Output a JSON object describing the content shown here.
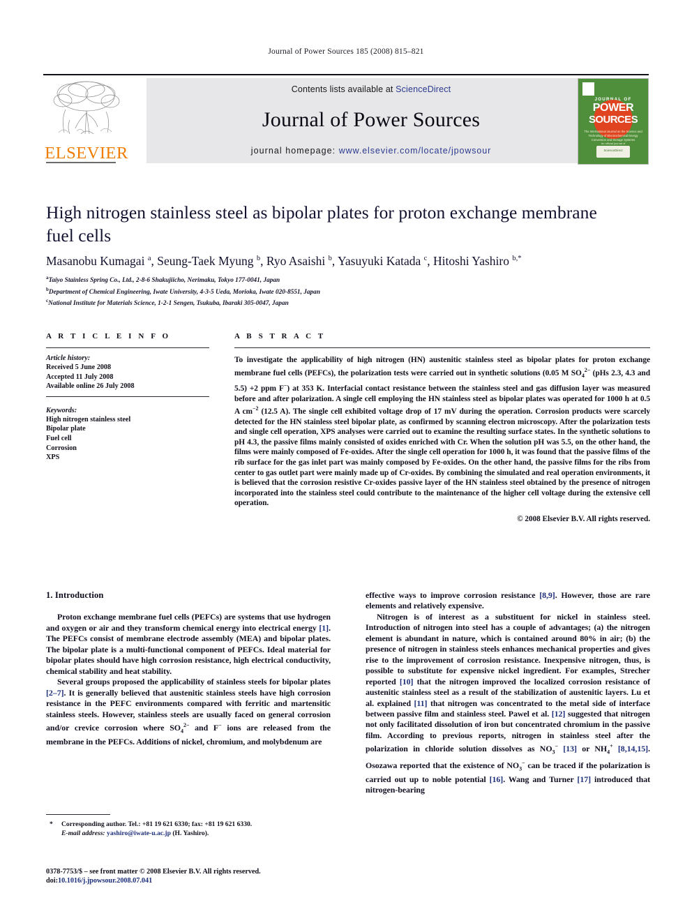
{
  "running_head": "Journal of Power Sources 185 (2008) 815–821",
  "masthead": {
    "publisher_logo_text": "ELSEVIER",
    "contents_prefix": "Contents lists available at ",
    "contents_link": "ScienceDirect",
    "journal_name": "Journal of Power Sources",
    "homepage_prefix": "journal homepage:",
    "homepage_url": "www.elsevier.com/locate/jpowsour",
    "cover": {
      "line1": "JOURNAL OF",
      "line2": "POWER",
      "line3": "SOURCES",
      "tagline": "The International Journal on the Science and Technology of Electro­chemical Energy Conversion and Storage Systems",
      "badge_top": "An official journal of",
      "badge": "ScienceDirect",
      "bg_color": "#4f8f3b",
      "circle_color": "#e0431f"
    }
  },
  "article": {
    "title": "High nitrogen stainless steel as bipolar plates for proton exchange membrane fuel cells",
    "authors_html": "Masanobu Kumagai <sup>a</sup>, Seung-Taek Myung <sup>b</sup>, Ryo Asaishi <sup>b</sup>, Yasuyuki Katada <sup>c</sup>, Hitoshi Yashiro <sup>b,*</sup>",
    "affiliations": [
      {
        "mark": "a",
        "text": "Taiyo Stainless Spring Co., Ltd., 2-8-6 Shakujiicho, Nerimaku, Tokyo 177-0041, Japan"
      },
      {
        "mark": "b",
        "text": "Department of Chemical Engineering, Iwate University, 4-3-5 Ueda, Morioka, Iwate 020-8551, Japan"
      },
      {
        "mark": "c",
        "text": "National Institute for Materials Science, 1-2-1 Sengen, Tsukuba, Ibaraki 305-0047, Japan"
      }
    ]
  },
  "article_info": {
    "heading": "A R T I C L E   I N F O",
    "history_label": "Article history:",
    "history": [
      "Received 5 June 2008",
      "Accepted 11 July 2008",
      "Available online 26 July 2008"
    ],
    "keywords_label": "Keywords:",
    "keywords": [
      "High nitrogen stainless steel",
      "Bipolar plate",
      "Fuel cell",
      "Corrosion",
      "XPS"
    ]
  },
  "abstract": {
    "heading": "A B S T R A C T",
    "text_html": "To investigate the applicability of high nitrogen (HN) austenitic stainless steel as bipolar plates for proton exchange membrane fuel cells (PEFCs), the polarization tests were carried out in synthetic solutions (0.05 M SO<sub>4</sub><sup>2−</sup> (pHs 2.3, 4.3 and 5.5) +2 ppm F<sup>−</sup>) at 353 K. Interfacial contact resistance between the stainless steel and gas diffusion layer was measured before and after polarization. A single cell employing the HN stainless steel as bipolar plates was operated for 1000 h at 0.5 A cm<sup>−2</sup> (12.5 A). The single cell exhibited voltage drop of 17 mV during the operation. Corrosion products were scarcely detected for the HN stainless steel bipolar plate, as confirmed by scanning electron microscopy. After the polarization tests and single cell operation, XPS analyses were carried out to examine the resulting surface states. In the synthetic solutions to pH 4.3, the passive films mainly consisted of oxides enriched with Cr. When the solution pH was 5.5, on the other hand, the films were mainly composed of Fe-oxides. After the single cell operation for 1000 h, it was found that the passive films of the rib surface for the gas inlet part was mainly composed by Fe-oxides. On the other hand, the passive films for the ribs from center to gas outlet part were mainly made up of Cr-oxides. By combining the simulated and real operation environments, it is believed that the corrosion resistive Cr-oxides passive layer of the HN stainless steel obtained by the presence of nitrogen incorporated into the stainless steel could contribute to the maintenance of the higher cell voltage during the extensive cell operation.",
    "copyright": "© 2008 Elsevier B.V. All rights reserved."
  },
  "body": {
    "section_heading": "1.  Introduction",
    "left_paragraphs_html": [
      "Proton exchange membrane fuel cells (PEFCs) are systems that use hydrogen and oxygen or air and they transform chemical energy into electrical energy <span class=\"ref\">[1]</span>. The PEFCs consist of membrane electrode assembly (MEA) and bipolar plates. The bipolar plate is a multi-functional component of PEFCs. Ideal material for bipolar plates should have high corrosion resistance, high electrical conductivity, chemical stability and heat stability.",
      "Several groups proposed the applicability of stainless steels for bipolar plates <span class=\"ref\">[2–7]</span>. It is generally believed that austenitic stainless steels have high corrosion resistance in the PEFC environments compared with ferritic and martensitic stainless steels. However, stainless steels are usually faced on general corrosion and/or crevice corrosion where SO<sub>4</sub><sup>2−</sup> and F<sup>−</sup> ions are released from the membrane in the PEFCs. Additions of nickel, chromium, and molybdenum are"
    ],
    "right_paragraphs_html": [
      "effective ways to improve corrosion resistance <span class=\"ref\">[8,9]</span>. However, those are rare elements and relatively expensive.",
      "Nitrogen is of interest as a substituent for nickel in stainless steel. Introduction of nitrogen into steel has a couple of advantages; (a) the nitrogen element is abundant in nature, which is contained around 80% in air; (b) the presence of nitrogen in stainless steels enhances mechanical properties and gives rise to the improvement of corrosion resistance. Inexpensive nitrogen, thus, is possible to substitute for expensive nickel ingredient. For examples, Strecher reported <span class=\"ref\">[10]</span> that the nitrogen improved the localized corrosion resistance of austenitic stainless steel as a result of the stabilization of austenitic layers. Lu et al. explained <span class=\"ref\">[11]</span> that nitrogen was concentrated to the metal side of interface between passive film and stainless steel. Pawel et al. <span class=\"ref\">[12]</span> suggested that nitrogen not only facilitated dissolution of iron but concentrated chromium in the passive film. According to previous reports, nitrogen in stainless steel after the polarization in chloride solution dissolves as NO<sub>3</sub><sup>−</sup> <span class=\"ref\">[13]</span> or NH<sub>4</sub><sup>+</sup> <span class=\"ref\">[8,14,15]</span>. Osozawa reported that the existence of NO<sub>3</sub><sup>−</sup> can be traced if the polarization is carried out up to noble potential <span class=\"ref\">[16]</span>. Wang and Turner <span class=\"ref\">[17]</span> introduced that nitrogen-bearing"
    ]
  },
  "footnotes": {
    "corresponding_marker": "*",
    "corresponding_text": "Corresponding author. Tel.: +81 19 621 6330; fax: +81 19 621 6330.",
    "email_label": "E-mail address:",
    "email": "yashiro@iwate-u.ac.jp",
    "email_owner": "(H. Yashiro).",
    "front_matter": "0378-7753/$ – see front matter © 2008 Elsevier B.V. All rights reserved.",
    "doi_label": "doi:",
    "doi": "10.1016/j.jpowsour.2008.07.041"
  }
}
